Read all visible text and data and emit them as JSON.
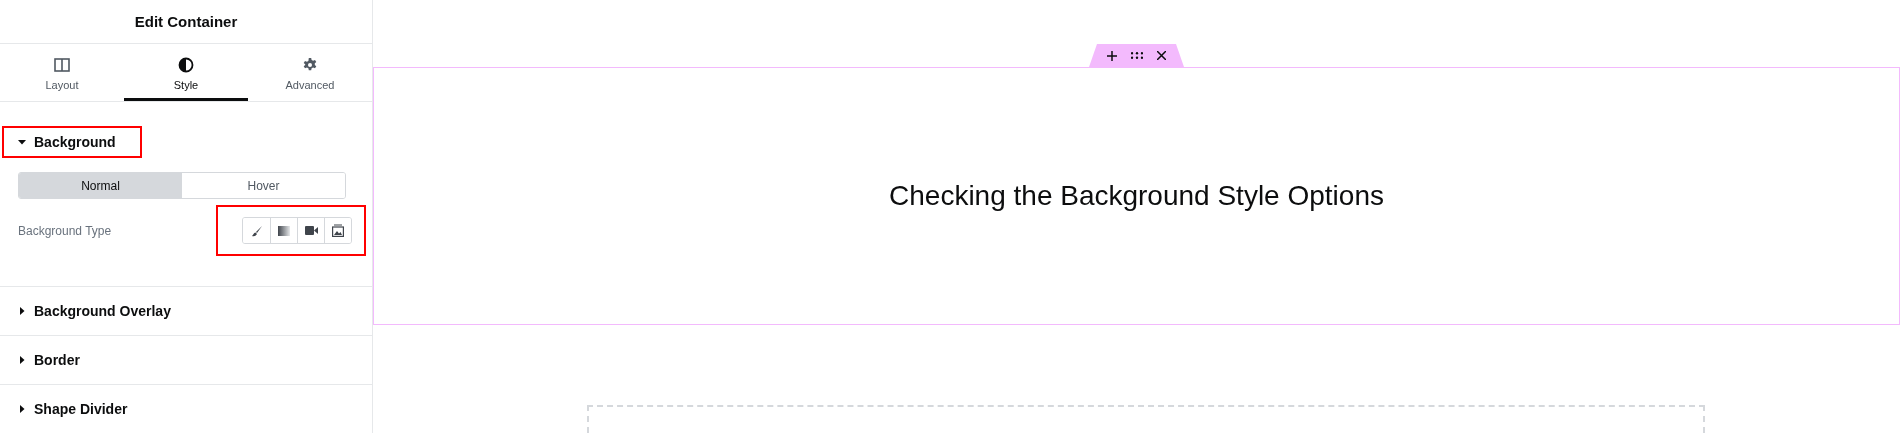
{
  "panel": {
    "title": "Edit Container",
    "tabs": [
      {
        "label": "Layout",
        "selected": false
      },
      {
        "label": "Style",
        "selected": true
      },
      {
        "label": "Advanced",
        "selected": false
      }
    ],
    "sections": [
      {
        "title": "Background",
        "expanded": true,
        "highlighted": true,
        "states": [
          {
            "label": "Normal",
            "selected": true
          },
          {
            "label": "Hover",
            "selected": false
          }
        ],
        "background_type": {
          "label": "Background Type",
          "highlighted": true,
          "options": [
            {
              "kind": "brush",
              "selected": false
            },
            {
              "kind": "gradient",
              "selected": false
            },
            {
              "kind": "video",
              "selected": false
            },
            {
              "kind": "slideshow",
              "selected": false
            }
          ]
        }
      },
      {
        "title": "Background Overlay",
        "expanded": false,
        "highlighted": false
      },
      {
        "title": "Border",
        "expanded": false,
        "highlighted": false
      },
      {
        "title": "Shape Divider",
        "expanded": false,
        "highlighted": false
      }
    ]
  },
  "canvas": {
    "container": {
      "selected": true,
      "heading": "Checking the Background Style Options",
      "handle": [
        {
          "kind": "add"
        },
        {
          "kind": "drag"
        },
        {
          "kind": "close"
        }
      ]
    }
  }
}
